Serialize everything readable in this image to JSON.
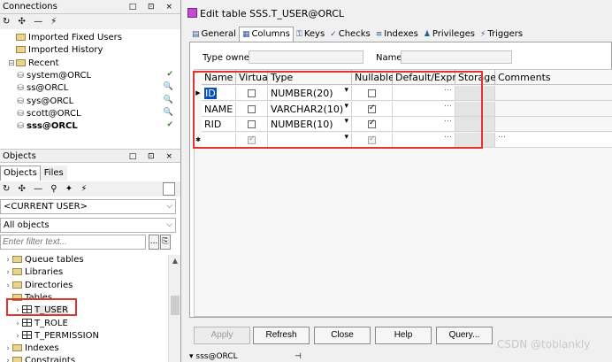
{
  "connections": {
    "title": "Connections",
    "controls": "□ ⊡ ×",
    "toolbar": "↻ ✣ — ⚡",
    "items": [
      {
        "label": "Imported Fixed Users",
        "type": "folder"
      },
      {
        "label": "Imported History",
        "type": "folder"
      },
      {
        "label": "Recent",
        "type": "folder-open"
      },
      {
        "label": "system@ORCL",
        "type": "conn",
        "status": "✔"
      },
      {
        "label": "ss@ORCL",
        "type": "conn",
        "status": "🔍"
      },
      {
        "label": "sys@ORCL",
        "type": "conn",
        "status": "🔍"
      },
      {
        "label": "scott@ORCL",
        "type": "conn",
        "status": "🔍"
      },
      {
        "label": "sss@ORCL",
        "type": "conn",
        "status": "✔",
        "bold": true
      }
    ]
  },
  "objects": {
    "title": "Objects",
    "controls": "□ ⊡ ×",
    "tabs": [
      "Objects",
      "Files"
    ],
    "toolbar": "↻ ✣ — ⚲ ✦ ⚡",
    "user_combo": "<CURRENT USER>",
    "scope_combo": "All objects",
    "filter_placeholder": "Enter filter text...",
    "filter_btn1": "...",
    "filter_btn2": "⎘",
    "tree": [
      {
        "label": "Queue tables",
        "type": "folder",
        "indent": 0
      },
      {
        "label": "Libraries",
        "type": "folder",
        "indent": 0
      },
      {
        "label": "Directories",
        "type": "folder",
        "indent": 0
      },
      {
        "label": "Tables",
        "type": "folder-open",
        "indent": 0
      },
      {
        "label": "T_USER",
        "type": "table",
        "indent": 1
      },
      {
        "label": "T_ROLE",
        "type": "table",
        "indent": 1
      },
      {
        "label": "T_PERMISSION",
        "type": "table",
        "indent": 1
      },
      {
        "label": "Indexes",
        "type": "folder",
        "indent": 0
      },
      {
        "label": "Constraints",
        "type": "folder",
        "indent": 0
      }
    ]
  },
  "editor": {
    "title": "Edit table SSS.T_USER@ORCL",
    "tabs": [
      {
        "label": "General",
        "icon": "▤"
      },
      {
        "label": "Columns",
        "icon": "▦",
        "active": true
      },
      {
        "label": "Keys",
        "icon": "⚿"
      },
      {
        "label": "Checks",
        "icon": "✓"
      },
      {
        "label": "Indexes",
        "icon": "≡"
      },
      {
        "label": "Privileges",
        "icon": "♟"
      },
      {
        "label": "Triggers",
        "icon": "⚡"
      }
    ],
    "type_owner_label": "Type owner",
    "name_label": "Name",
    "columns": [
      "Name",
      "Virtual",
      "Type",
      "Nullable",
      "Default/Expr.",
      "Storage",
      "Comments"
    ],
    "rows": [
      {
        "name": "ID",
        "virtual": false,
        "type": "NUMBER(20)",
        "nullable": false,
        "default": "",
        "selected": true
      },
      {
        "name": "NAME",
        "virtual": false,
        "type": "VARCHAR2(10)",
        "nullable": true,
        "default": ""
      },
      {
        "name": "RID",
        "virtual": false,
        "type": "NUMBER(10)",
        "nullable": true,
        "default": ""
      },
      {
        "name": "",
        "virtual": true,
        "type": "",
        "nullable": true,
        "default": "",
        "new": true
      }
    ],
    "row_marker_current": "▶",
    "row_marker_new": "✱",
    "buttons": {
      "apply": "Apply",
      "refresh": "Refresh",
      "close": "Close",
      "help": "Help",
      "query": "Query..."
    }
  },
  "statusbar": {
    "session": "sss@ORCL",
    "pin": "⊣"
  },
  "watermark": "CSDN @toblankly"
}
